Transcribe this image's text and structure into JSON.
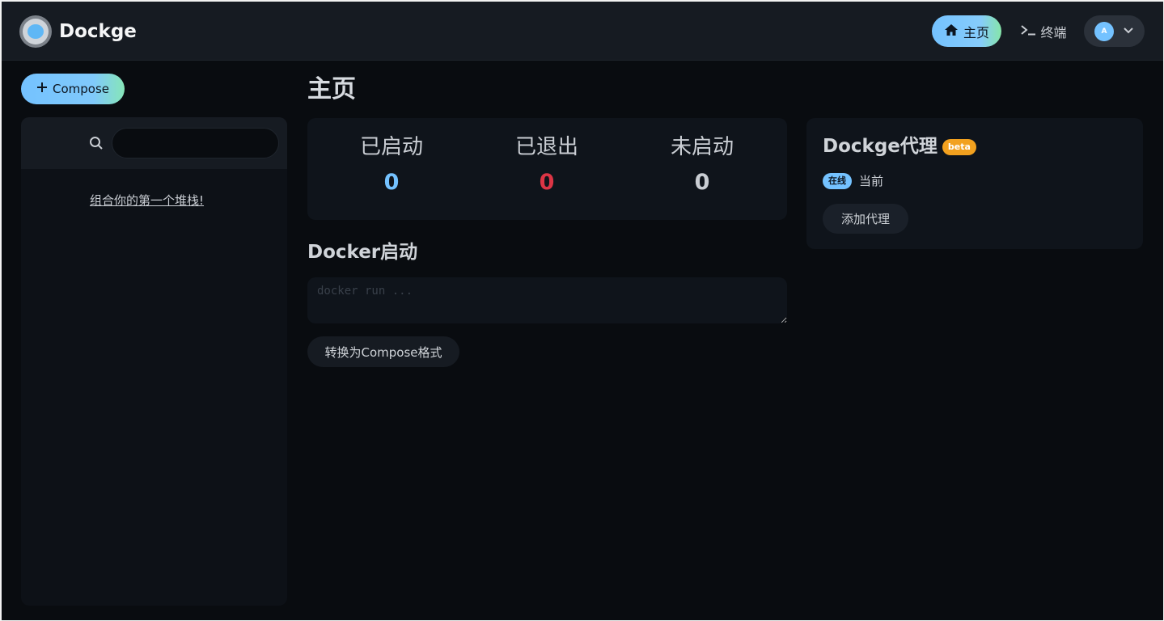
{
  "header": {
    "brand": "Dockge",
    "nav_home": "主页",
    "nav_terminal": "终端",
    "avatar_initial": "A"
  },
  "sidebar": {
    "compose_button": "Compose",
    "search_placeholder": "",
    "empty_text": "组合你的第一个堆栈!"
  },
  "main": {
    "title": "主页",
    "stats": [
      {
        "label": "已启动",
        "value": "0",
        "color": "#74c2ff"
      },
      {
        "label": "已退出",
        "value": "0",
        "color": "#dc3545"
      },
      {
        "label": "未启动",
        "value": "0",
        "color": "#c9cdd3"
      }
    ],
    "docker_run_title": "Docker启动",
    "docker_run_placeholder": "docker run ...",
    "convert_button": "转换为Compose格式"
  },
  "agents": {
    "title": "Dockge代理",
    "beta_badge": "beta",
    "items": [
      {
        "status": "在线",
        "name": "当前"
      }
    ],
    "add_button": "添加代理"
  },
  "colors": {
    "accent": "#74c2ff",
    "danger": "#dc3545",
    "warning": "#f2a11f",
    "background": "#090c10",
    "panel": "#0f141b"
  },
  "icons": {
    "home": "home-icon",
    "terminal": "terminal-icon",
    "plus": "plus-icon",
    "search": "search-icon",
    "chevron": "chevron-down-icon"
  }
}
